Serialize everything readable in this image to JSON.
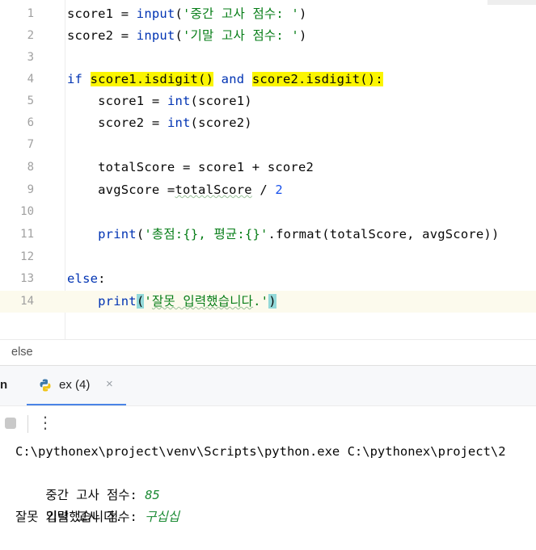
{
  "editor": {
    "line_numbers": [
      "1",
      "2",
      "3",
      "4",
      "5",
      "6",
      "7",
      "8",
      "9",
      "10",
      "11",
      "12",
      "13",
      "14"
    ],
    "code": {
      "l1": {
        "var": "score1 = ",
        "fn": "input",
        "open": "(",
        "str": "'중간 고사 점수: '",
        "close": ")"
      },
      "l2": {
        "var": "score2 = ",
        "fn": "input",
        "open": "(",
        "str": "'기말 고사 점수: '",
        "close": ")"
      },
      "l4": {
        "kw_if": "if",
        "sp": " ",
        "hl1": "score1.isdigit()",
        "and": " and ",
        "hl2": "score2.isdigit():"
      },
      "l5": {
        "indent": "    ",
        "var": "score1 = ",
        "fn": "int",
        "rest": "(score1)"
      },
      "l6": {
        "indent": "    ",
        "var": "score2 = ",
        "fn": "int",
        "rest": "(score2)"
      },
      "l8": {
        "text": "    totalScore = score1 + score2"
      },
      "l9": {
        "pre": "    avgScore =",
        "wavy": "totalScore",
        "mid": " / ",
        "num": "2"
      },
      "l11": {
        "indent": "    ",
        "fn": "print",
        "open": "(",
        "str": "'총점:{}, 평균:{}'",
        "rest": ".format(totalScore, avgScore))"
      },
      "l13": {
        "kw_else": "else",
        "colon": ":"
      },
      "l14": {
        "indent": "    ",
        "fn": "print",
        "open": "(",
        "str_open": "'",
        "str_body": "잘못 입력했습니다",
        "str_close": ".'",
        "close": ")"
      }
    }
  },
  "breadcrumb": {
    "label": "else"
  },
  "run_window": {
    "title": "n",
    "tab": {
      "label": "ex (4)",
      "close": "×"
    },
    "toolbar": {
      "menu": "⋮"
    }
  },
  "console": {
    "command": "C:\\pythonex\\project\\venv\\Scripts\\python.exe C:\\pythonex\\project\\2",
    "prompt1": "중간 고사 점수: ",
    "input1": "85",
    "prompt2": "기말 고사 점수: ",
    "input2": "구십십",
    "output": "잘못 입력했습니다."
  },
  "colors": {
    "keyword": "#0033b3",
    "string": "#067d17",
    "number": "#1750eb",
    "highlight": "#fbf500",
    "brace_match": "#93d9d9",
    "tab_accent": "#4a84e6"
  }
}
